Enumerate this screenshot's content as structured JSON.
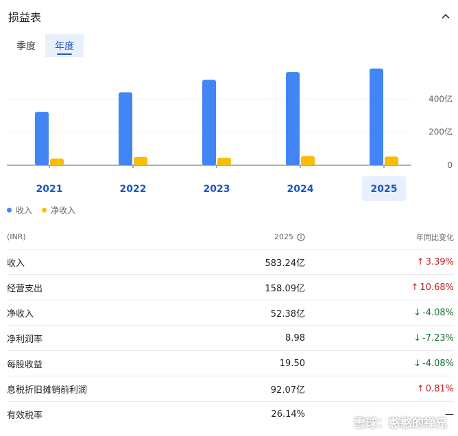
{
  "header": {
    "title": "损益表"
  },
  "tabs": [
    {
      "label": "季度",
      "active": false
    },
    {
      "label": "年度",
      "active": true
    }
  ],
  "colors": {
    "revenue": "#4285f4",
    "net_income": "#fbbc04",
    "up": "#c5221f",
    "down": "#137333",
    "accent": "#1a56c4"
  },
  "chart_data": {
    "type": "bar",
    "categories": [
      "2021",
      "2022",
      "2023",
      "2024",
      "2025"
    ],
    "series": [
      {
        "name": "收入",
        "values": [
          322,
          440,
          515,
          562,
          583.24
        ]
      },
      {
        "name": "净收入",
        "values": [
          40,
          50,
          45,
          56,
          52.38
        ]
      }
    ],
    "y_ticks": [
      "0",
      "200亿",
      "400亿"
    ],
    "ylim": [
      0,
      600
    ],
    "selected_category": "2025",
    "grid": true
  },
  "legend": [
    {
      "label": "收入",
      "color": "#4285f4"
    },
    {
      "label": "净收入",
      "color": "#fbbc04"
    }
  ],
  "table": {
    "header": {
      "currency": "(INR)",
      "period": "2025",
      "change": "年同比变化"
    },
    "rows": [
      {
        "label": "收入",
        "value": "583.24亿",
        "change": "3.39%",
        "direction": "up"
      },
      {
        "label": "经营支出",
        "value": "158.09亿",
        "change": "10.68%",
        "direction": "up"
      },
      {
        "label": "净收入",
        "value": "52.38亿",
        "change": "-4.08%",
        "direction": "down"
      },
      {
        "label": "净利润率",
        "value": "8.98",
        "change": "-7.23%",
        "direction": "down"
      },
      {
        "label": "每股收益",
        "value": "19.50",
        "change": "-4.08%",
        "direction": "down"
      },
      {
        "label": "息税折旧摊销前利润",
        "value": "92.07亿",
        "change": "0.81%",
        "direction": "up"
      },
      {
        "label": "有效税率",
        "value": "26.14%",
        "change": "—",
        "direction": "none"
      }
    ]
  },
  "watermark": {
    "text": "雪球：憨憨的禅兄"
  }
}
